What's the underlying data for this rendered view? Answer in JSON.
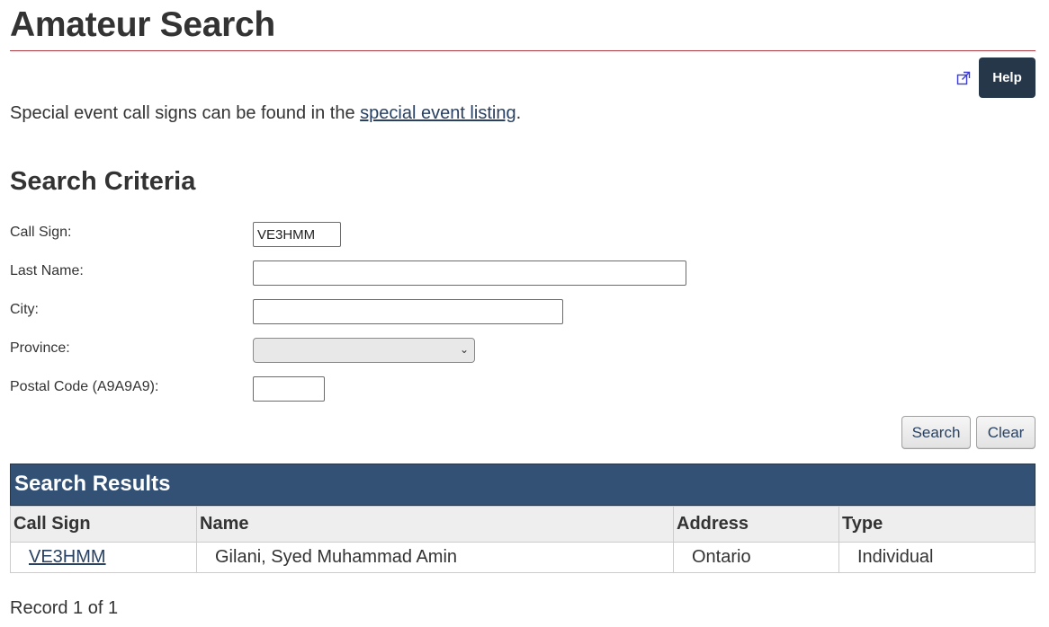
{
  "page": {
    "title": "Amateur Search"
  },
  "help": {
    "label": "Help",
    "icon": "external-link-icon"
  },
  "intro": {
    "text_before": "Special event call signs can be found in the ",
    "link_text": "special event listing",
    "text_after": "."
  },
  "criteria": {
    "heading": "Search Criteria",
    "call_sign_label": "Call Sign:",
    "call_sign_value": "VE3HMM",
    "last_name_label": "Last Name:",
    "last_name_value": "",
    "city_label": "City:",
    "city_value": "",
    "province_label": "Province:",
    "province_value": "",
    "postal_code_label": "Postal Code (A9A9A9):",
    "postal_code_value": ""
  },
  "buttons": {
    "search": "Search",
    "clear": "Clear"
  },
  "results": {
    "heading": "Search Results",
    "columns": [
      "Call Sign",
      "Name",
      "Address",
      "Type"
    ],
    "rows": [
      {
        "call_sign": "VE3HMM",
        "name": "Gilani, Syed Muhammad Amin",
        "address": "Ontario",
        "type": "Individual"
      }
    ],
    "record_count": "Record 1 of 1"
  },
  "colors": {
    "accent_rule": "#af3c43",
    "header_bg": "#335075",
    "help_bg": "#26374a",
    "link": "#284162"
  }
}
